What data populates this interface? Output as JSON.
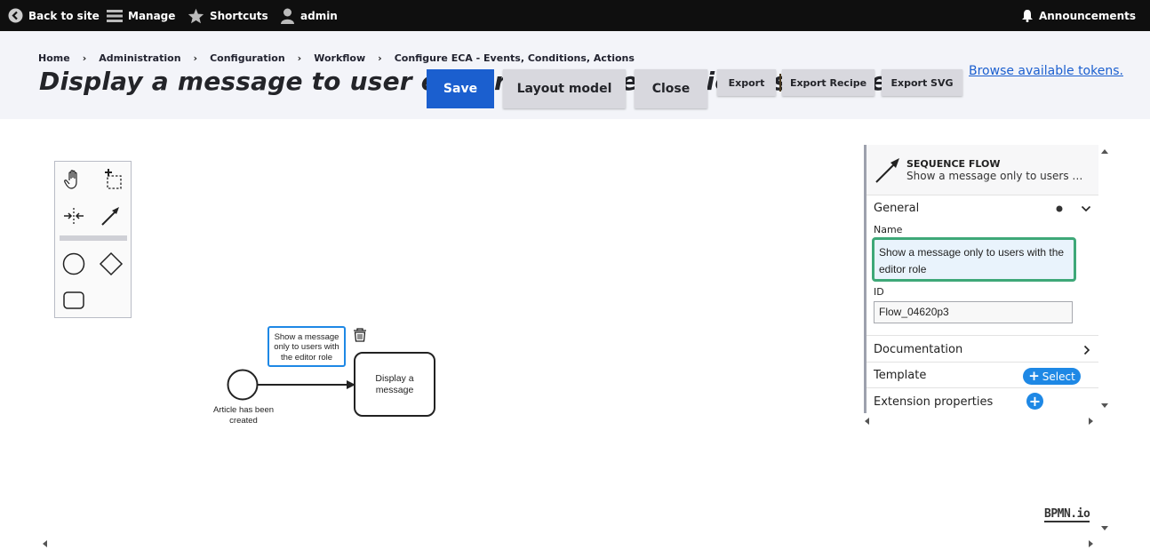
{
  "toolbar": {
    "back_label": "Back to site",
    "manage_label": "Manage",
    "shortcuts_label": "Shortcuts",
    "user_label": "admin",
    "announcements_label": "Announcements"
  },
  "breadcrumb": [
    "Home",
    "Administration",
    "Configuration",
    "Workflow",
    "Configure ECA - Events, Conditions, Actions"
  ],
  "page_title": "Display a message to user editor role when article is created",
  "buttons": {
    "save": "Save",
    "layout": "Layout model",
    "close": "Close",
    "export": "Export",
    "export_recipe": "Export Recipe",
    "export_svg": "Export SVG"
  },
  "tokens_link": "Browse available tokens.",
  "diagram": {
    "start_event_label_1": "Article has been",
    "start_event_label_2": "created",
    "task_label_1": "Display a",
    "task_label_2": "message",
    "flow_label_1": "Show a message",
    "flow_label_2": "only to users with",
    "flow_label_3": "the editor role"
  },
  "properties": {
    "element_type": "SEQUENCE FLOW",
    "element_name": "Show a message only to users wit…",
    "general_label": "General",
    "name_label": "Name",
    "name_value": "Show a message only to users with the editor role",
    "id_label": "ID",
    "id_value": "Flow_04620p3",
    "documentation_label": "Documentation",
    "template_label": "Template",
    "select_label": "Select",
    "extension_label": "Extension properties"
  },
  "logo_text": "BPMN.io",
  "colors": {
    "primary": "#1b5fcf",
    "selection": "#1e88e5",
    "focus": "#3ea878"
  }
}
